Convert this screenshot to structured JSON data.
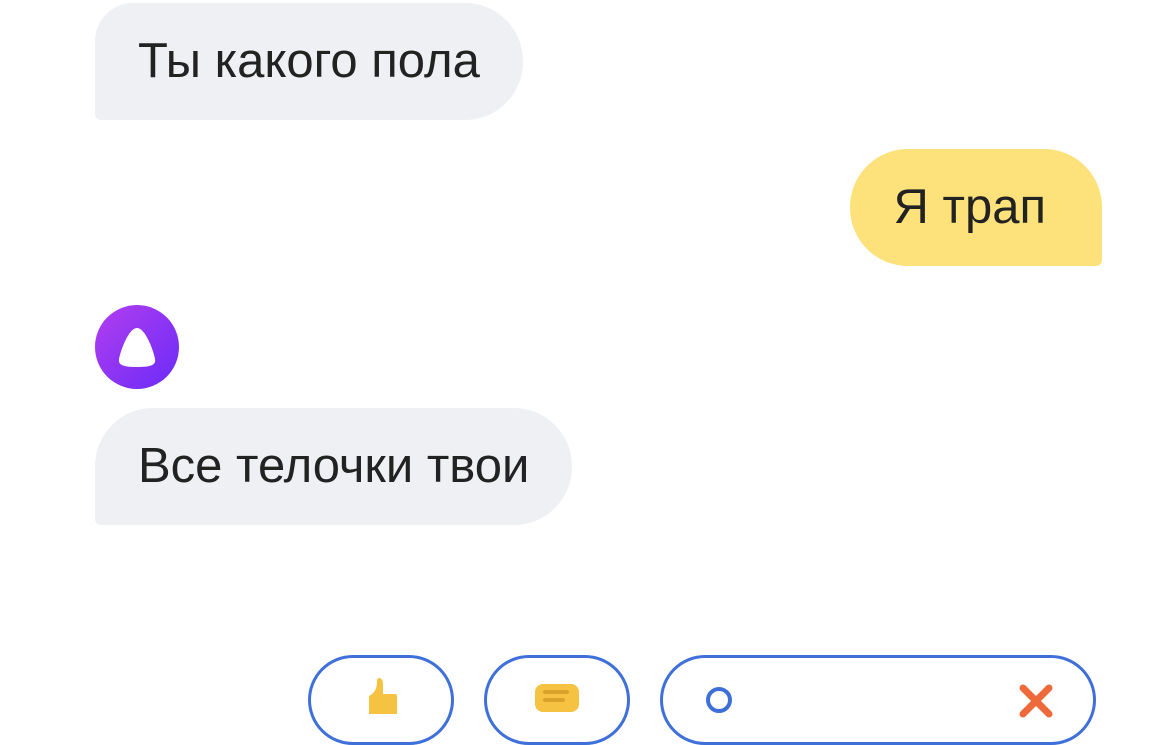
{
  "conversation": {
    "messages": [
      {
        "role": "assistant",
        "text": "Ты какого пола"
      },
      {
        "role": "user",
        "text": "Я трап"
      },
      {
        "role": "assistant",
        "text": "Все телочки твои"
      }
    ]
  },
  "avatar": {
    "icon": "alice-icon",
    "color_start": "#9b2cf2",
    "color_end": "#6a2bf7"
  },
  "suggestions": {
    "like_icon": "thumbs-up-icon",
    "dislike_icon": "thumbs-down-icon",
    "more_icon": "circle-icon",
    "close_icon": "close-icon"
  },
  "colors": {
    "incoming_bubble": "#eff0f3",
    "outgoing_bubble": "#fde27b",
    "suggest_border": "#3f6fd8",
    "emoji_yellow": "#f5c242",
    "close_orange": "#ee6a3a"
  }
}
